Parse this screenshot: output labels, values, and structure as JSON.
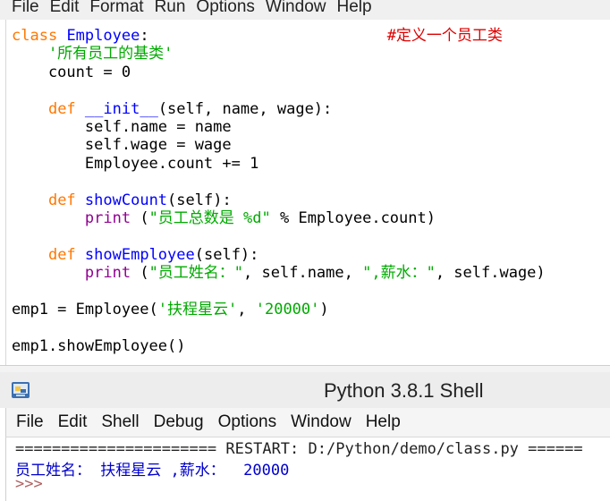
{
  "editor_menu": [
    "File",
    "Edit",
    "Format",
    "Run",
    "Options",
    "Window",
    "Help"
  ],
  "code": {
    "l1_class_kw": "class",
    "l1_class_name": "Employee",
    "l1_colon": ":",
    "l1_gap": "                          ",
    "l1_comment": "#定义一个员工类",
    "l2": "    '所有员工的基类'",
    "l3": "    count = 0",
    "l5_def": "def",
    "l5_name": "__init__",
    "l5_rest": "(self, name, wage):",
    "l6": "        self.name = name",
    "l7": "        self.wage = wage",
    "l8": "        Employee.count += 1",
    "l10_name": "showCount",
    "l10_rest": "(self):",
    "l11_print": "print",
    "l11_str": "\"员工总数是 %d\"",
    "l11_rest": " % Employee.count)",
    "l13_name": "showEmployee",
    "l13_rest": "(self):",
    "l14_print": "print",
    "l14_str1": "\"员工姓名：\"",
    "l14_mid": ", self.name, ",
    "l14_str2": "\",薪水：\"",
    "l14_rest": ", self.wage)",
    "l16_pre": "emp1 = Employee(",
    "l16_str1": "'扶程星云'",
    "l16_comma": ", ",
    "l16_str2": "'20000'",
    "l16_post": ")",
    "l18": "emp1.showEmployee()"
  },
  "shell": {
    "title": "Python 3.8.1 Shell",
    "menu": [
      "File",
      "Edit",
      "Shell",
      "Debug",
      "Options",
      "Window",
      "Help"
    ],
    "restart_line": "====================== RESTART: D:/Python/demo/class.py ======",
    "output_line": "员工姓名： 扶程星云 ,薪水：  20000",
    "prompt": ">>>"
  },
  "colors": {
    "keyword": "#ff7700",
    "definition": "#0000ff",
    "string": "#00aa00",
    "builtin": "#900090",
    "comment": "#dd0000",
    "shell_output": "#0000cc"
  },
  "icons": [
    "python-idle-icon"
  ]
}
